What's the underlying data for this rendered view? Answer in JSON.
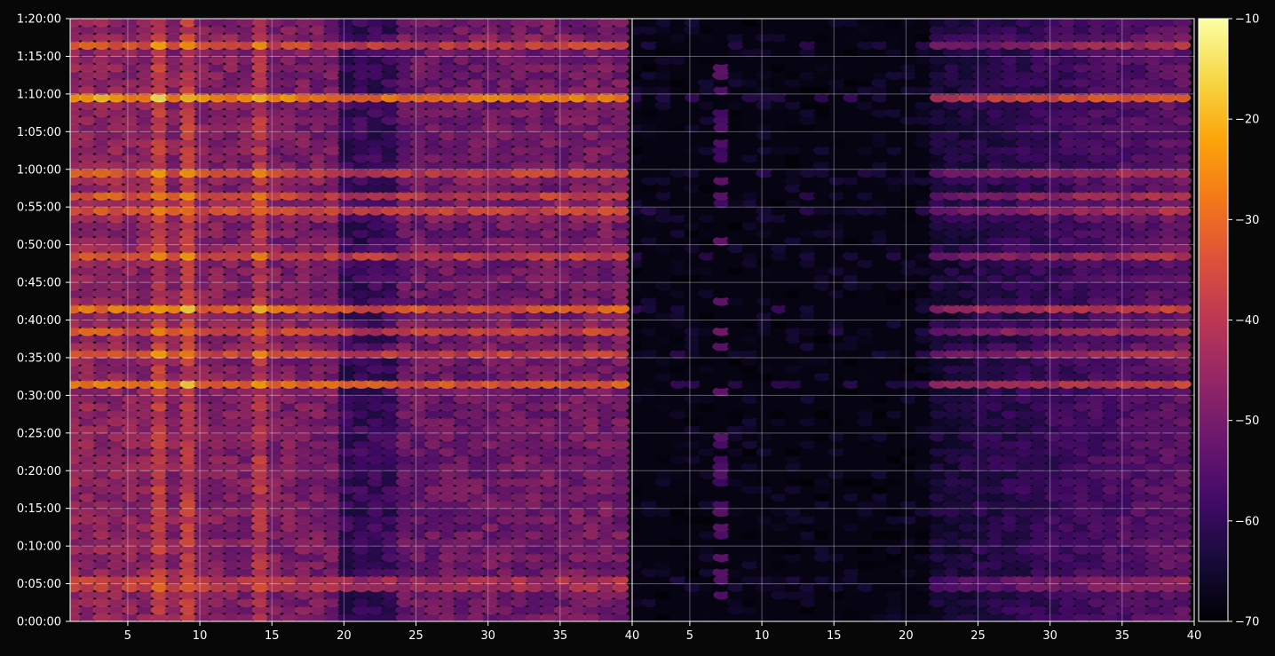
{
  "chart_data": {
    "type": "heatmap",
    "layout": "two panels side by side sharing the y axis, shared colorbar on the right",
    "background": "#070707",
    "colormap": "inferno",
    "grid": true,
    "value_range": [
      -70,
      -10
    ],
    "colorbar": {
      "ticks": [
        -10,
        -20,
        -30,
        -40,
        -50,
        -60,
        -70
      ],
      "tick_labels": [
        "−10",
        "−20",
        "−30",
        "−40",
        "−50",
        "−60",
        "−70"
      ]
    },
    "y_axis": {
      "range_seconds": [
        0,
        4800
      ],
      "tick_labels": [
        "0:00:00",
        "0:05:00",
        "0:10:00",
        "0:15:00",
        "0:20:00",
        "0:25:00",
        "0:30:00",
        "0:35:00",
        "0:40:00",
        "0:45:00",
        "0:50:00",
        "0:55:00",
        "1:00:00",
        "1:05:00",
        "1:10:00",
        "1:15:00",
        "1:20:00"
      ]
    },
    "panels": [
      {
        "x_range": [
          1,
          40
        ],
        "x_ticks": [
          5,
          10,
          15,
          20,
          25,
          30,
          35,
          40
        ],
        "x_tick_labels": [
          "5",
          "10",
          "15",
          "20",
          "25",
          "30",
          "35",
          "40"
        ],
        "strong_rows_seconds": [
          300,
          1900,
          2150,
          2330,
          2500,
          2930,
          3250,
          3370,
          3550,
          4170,
          4610
        ],
        "bright_columns": [
          7,
          9,
          14
        ],
        "intensity": "strong"
      },
      {
        "x_range": [
          1,
          40
        ],
        "x_ticks": [
          5,
          10,
          15,
          20,
          25,
          30,
          35,
          40
        ],
        "x_tick_labels": [
          "5",
          "10",
          "15",
          "20",
          "25",
          "30",
          "35",
          "40"
        ],
        "strong_rows_seconds": [
          300,
          1900,
          2150,
          2330,
          2500,
          2930,
          3250,
          3370,
          3550,
          4170,
          4610
        ],
        "bright_columns": [
          7
        ],
        "intensity": "weak"
      }
    ]
  }
}
